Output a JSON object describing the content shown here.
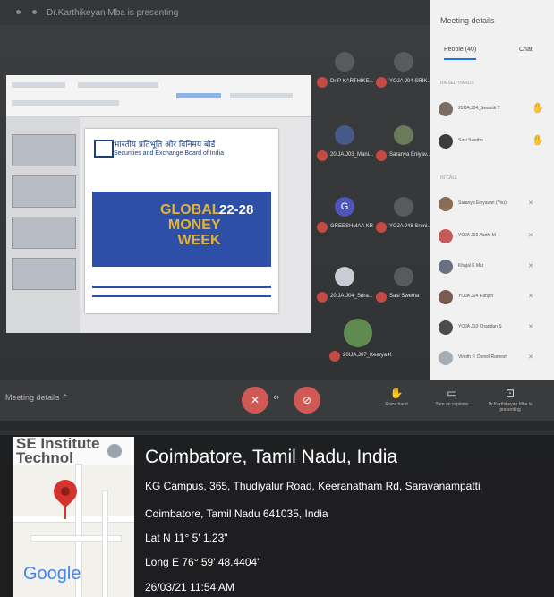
{
  "screen": {
    "presenting_banner": "Dr.Karthikeyan Mba is presenting"
  },
  "slide": {
    "org_hindi": "भारतीय प्रतिभूति और विनिमय बोर्ड",
    "org_english": "Securities and Exchange Board of India",
    "banner_line1": "GLOBAL",
    "banner_line2": "MONEY",
    "banner_line3": "WEEK",
    "banner_dates": "22-28"
  },
  "tiles": [
    {
      "name": "Dr P KARTHIKE..."
    },
    {
      "name": "YOJA J04 SRIK..."
    },
    {
      "name": "20IJA,J03_Mani..."
    },
    {
      "name": "Saranya Eniyav..."
    },
    {
      "name": "GREESHMAA KR",
      "initial": "G"
    },
    {
      "name": "YOJA J48 Sreni..."
    },
    {
      "name": "20IJA,J04_Srira..."
    },
    {
      "name": "Sasi Swetha"
    },
    {
      "name": "20IJA,J07_Keerya K"
    }
  ],
  "panel": {
    "title": "Meeting details",
    "tab_people": "People (40)",
    "tab_chat": "Chat",
    "section_raised": "RAISED HANDS",
    "section_in_call": "IN CALL",
    "raised": [
      {
        "name": "20IJA,J04_Swastik T"
      },
      {
        "name": "Sasi Swetha"
      }
    ],
    "in_call": [
      {
        "name": "Saranya Eniyavan (You)"
      },
      {
        "name": "YOJA J03 Aarthi M"
      },
      {
        "name": "Khajal K Mur"
      },
      {
        "name": "YOJA J04 Ranjith"
      },
      {
        "name": "YOJA J10 Chandan S"
      },
      {
        "name": "Vinoth P. Daniel Ramesh"
      }
    ]
  },
  "bottombar": {
    "meeting_details": "Meeting details",
    "raise_hand": "Raise hand",
    "turn_on_captions": "Turn on captions",
    "present": "Dr.Karthikeyan Mba is presenting"
  },
  "overlay": {
    "map_label_top": "SE Institute Technol",
    "map_brand": "Google",
    "city": "Coimbatore, Tamil Nadu, India",
    "address_line1": "KG Campus, 365, Thudiyalur Road, Keeranatham Rd, Saravanampatti,",
    "address_line2": "Coimbatore, Tamil Nadu 641035, India",
    "lat": "Lat N 11° 5' 1.23\"",
    "long": "Long E 76° 59' 48.4404\"",
    "datetime": "26/03/21 11:54 AM"
  }
}
